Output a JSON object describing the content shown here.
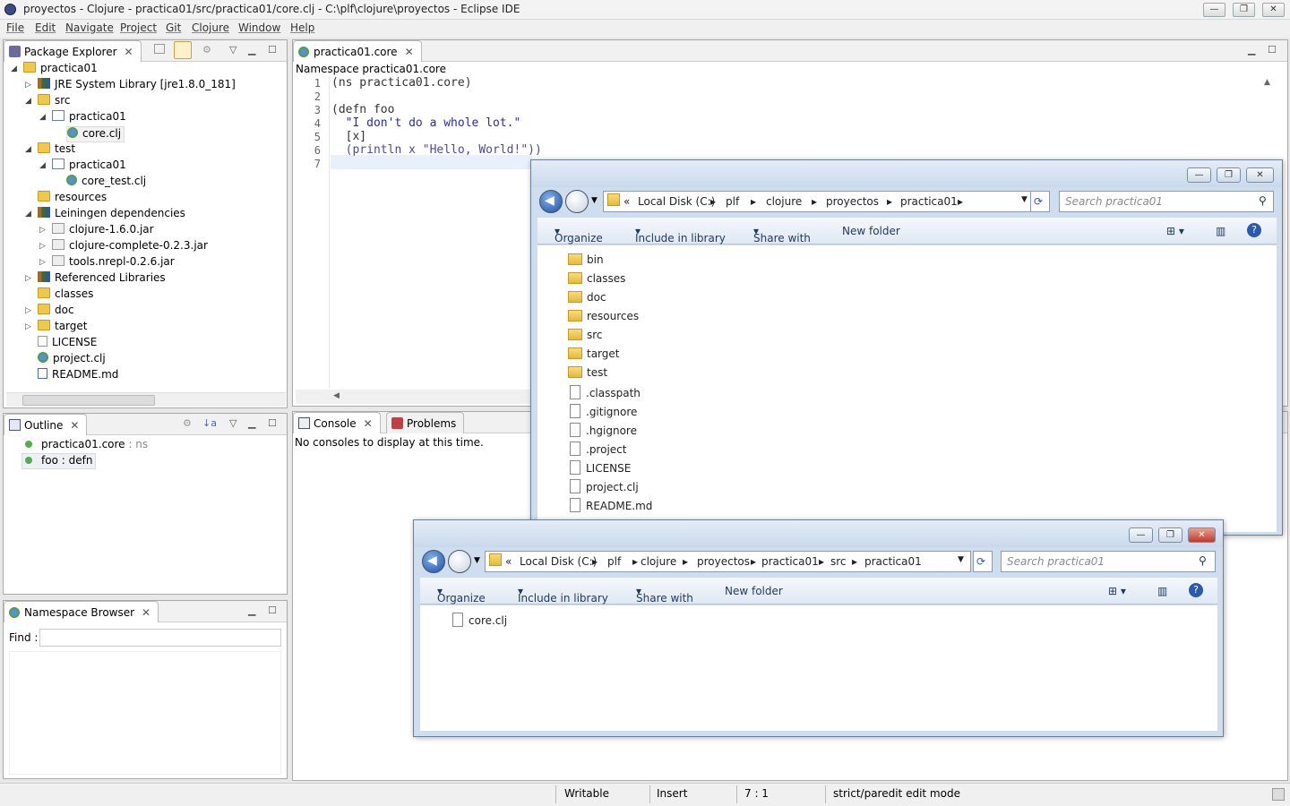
{
  "window": {
    "title": "proyectos - Clojure - practica01/src/practica01/core.clj - C:\\plf\\clojure\\proyectos - Eclipse IDE",
    "minimize": "—",
    "restore": "❐",
    "close": "✕"
  },
  "menu": [
    "File",
    "Edit",
    "Navigate",
    "Project",
    "Git",
    "Clojure",
    "Window",
    "Help"
  ],
  "package_explorer": {
    "tab_label": "Package Explorer",
    "items": [
      {
        "label": "practica01"
      },
      {
        "label": "JRE System Library [jre1.8.0_181]"
      },
      {
        "label": "src"
      },
      {
        "label": "practica01"
      },
      {
        "label": "core.clj"
      },
      {
        "label": "test"
      },
      {
        "label": "practica01"
      },
      {
        "label": "core_test.clj"
      },
      {
        "label": "resources"
      },
      {
        "label": "Leiningen dependencies"
      },
      {
        "label": "clojure-1.6.0.jar"
      },
      {
        "label": "clojure-complete-0.2.3.jar"
      },
      {
        "label": "tools.nrepl-0.2.6.jar"
      },
      {
        "label": "Referenced Libraries"
      },
      {
        "label": "classes"
      },
      {
        "label": "doc"
      },
      {
        "label": "target"
      },
      {
        "label": "LICENSE"
      },
      {
        "label": "project.clj"
      },
      {
        "label": "README.md"
      }
    ]
  },
  "outline": {
    "tab_label": "Outline",
    "items": [
      {
        "name": "practica01.core",
        "kind": " : ns"
      },
      {
        "name": "foo",
        "kind": " : defn"
      }
    ]
  },
  "namespace_browser": {
    "tab_label": "Namespace Browser",
    "find_label": "Find :",
    "find_value": ""
  },
  "editor": {
    "tab_label": "practica01.core",
    "breadcrumb": "Namespace practica01.core",
    "lines": [
      {
        "n": "1",
        "text": "(ns practica01.core)"
      },
      {
        "n": "2",
        "text": ""
      },
      {
        "n": "3",
        "text": "(defn foo"
      },
      {
        "n": "4",
        "text": "  \"I don't do a whole lot.\""
      },
      {
        "n": "5",
        "text": "  [x]"
      },
      {
        "n": "6",
        "text": "  (println x \"Hello, World!\"))"
      },
      {
        "n": "7",
        "text": ""
      }
    ]
  },
  "console": {
    "tab_console": "Console",
    "tab_problems": "Problems",
    "message": "No consoles to display at this time."
  },
  "explorer1": {
    "path": [
      "«",
      "Local Disk (C:)",
      "plf",
      "clojure",
      "proyectos",
      "practica01"
    ],
    "search_placeholder": "Search practica01",
    "commands": [
      "Organize",
      "Include in library",
      "Share with",
      "New folder"
    ],
    "folders": [
      "bin",
      "classes",
      "doc",
      "resources",
      "src",
      "target",
      "test"
    ],
    "files": [
      ".classpath",
      ".gitignore",
      ".hgignore",
      ".project",
      "LICENSE",
      "project.clj",
      "README.md"
    ]
  },
  "explorer2": {
    "path": [
      "«",
      "Local Disk (C:)",
      "plf",
      "clojure",
      "proyectos",
      "practica01",
      "src",
      "practica01"
    ],
    "search_placeholder": "Search practica01",
    "commands": [
      "Organize",
      "Include in library",
      "Share with",
      "New folder"
    ],
    "files": [
      "core.clj"
    ]
  },
  "statusbar": {
    "writable": "Writable",
    "insert": "Insert",
    "position": "7 : 1",
    "mode": "strict/paredit edit mode"
  },
  "colors": {
    "keyword_blue": "#2020c0",
    "string_blue": "#1a1aa6",
    "selection": "#e8f0fb"
  }
}
